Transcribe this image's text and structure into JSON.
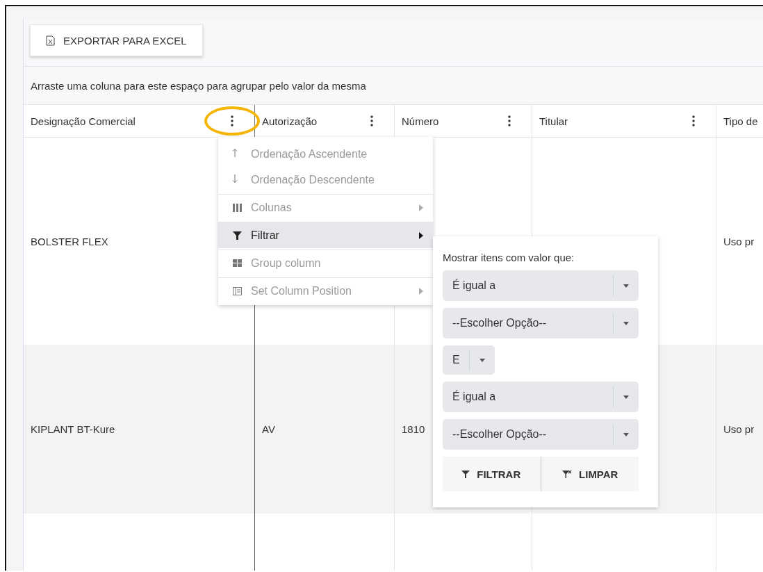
{
  "toolbar": {
    "export_button": "EXPORTAR PARA EXCEL"
  },
  "group_panel": {
    "hint": "Arraste uma coluna para este espaço para agrupar pelo valor da mesma"
  },
  "table": {
    "columns": [
      {
        "label": "Designação Comercial",
        "menu": true,
        "highlighted": true
      },
      {
        "label": "Autorização",
        "menu": true,
        "highlighted": false
      },
      {
        "label": "Número",
        "menu": true,
        "highlighted": false
      },
      {
        "label": "Titular",
        "menu": true,
        "highlighted": false
      },
      {
        "label": "Tipo de",
        "menu": false,
        "highlighted": false
      }
    ],
    "rows": [
      {
        "cells": [
          "BOLSTER FLEX",
          null,
          null,
          null,
          "Uso pr"
        ],
        "selected": false
      },
      {
        "cells": [
          "KIPLANT BT-Kure",
          "AV",
          "1810",
          null,
          "Uso pr"
        ],
        "selected": true
      },
      {
        "cells": [
          null,
          null,
          null,
          null,
          null
        ],
        "selected": false
      }
    ]
  },
  "column_menu": {
    "sections": [
      [
        {
          "kind": "sort-asc",
          "label": "Ordenação Ascendente",
          "selected": false,
          "submenu": false
        },
        {
          "kind": "sort-desc",
          "label": "Ordenação Descendente",
          "selected": false,
          "submenu": false
        }
      ],
      [
        {
          "kind": "columns",
          "label": "Colunas",
          "selected": false,
          "submenu": true
        }
      ],
      [
        {
          "kind": "filter",
          "label": "Filtrar",
          "selected": true,
          "submenu": true
        }
      ],
      [
        {
          "kind": "group",
          "label": "Group column",
          "selected": false,
          "submenu": false
        }
      ],
      [
        {
          "kind": "position",
          "label": "Set Column Position",
          "selected": false,
          "submenu": true
        }
      ]
    ]
  },
  "filter_panel": {
    "label": "Mostrar itens com valor que:",
    "first": [
      {
        "value": "É igual a"
      },
      {
        "value": "--Escolher Opção--"
      }
    ],
    "logic": {
      "value": "E"
    },
    "second": [
      {
        "value": "É igual a"
      },
      {
        "value": "--Escolher Opção--"
      }
    ],
    "buttons": [
      {
        "kind": "filter",
        "label": "FILTRAR"
      },
      {
        "kind": "clear",
        "label": "LIMPAR"
      }
    ]
  }
}
